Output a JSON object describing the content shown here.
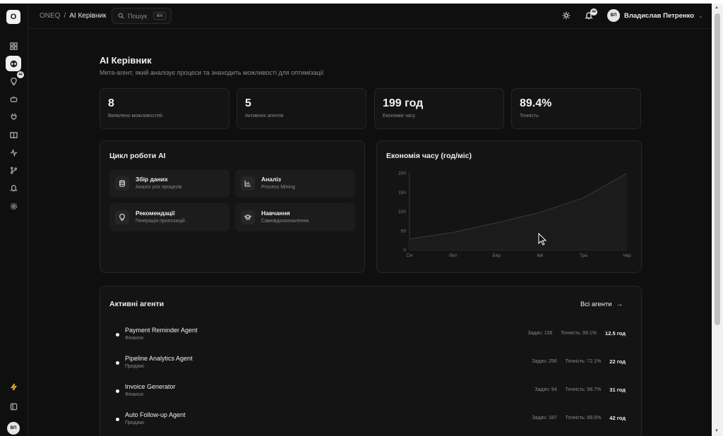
{
  "sidebar": {
    "logo": "O",
    "badge": "44",
    "avatar": "ВП",
    "icons": [
      "dashboard-icon",
      "brain-icon",
      "lightbulb-icon",
      "bot-icon",
      "plug-icon",
      "book-icon",
      "activity-icon",
      "git-branch-icon",
      "bell-icon",
      "settings-icon",
      "zap-icon",
      "sidebar-toggle-icon"
    ]
  },
  "topbar": {
    "crumb_root": "ONEQ",
    "crumb_sep": "/",
    "crumb_current": "AI Керівник",
    "search_placeholder": "Пошук",
    "search_shortcut": "⌘K",
    "notif_count": "44",
    "user_initials": "ВП",
    "user_name": "Владислав Петренко"
  },
  "page": {
    "title": "AI Керівник",
    "subtitle": "Мета-агент, який аналізує процеси та знаходить можливості для оптимізації"
  },
  "stats": [
    {
      "value": "8",
      "label": "Виявлено можливостей"
    },
    {
      "value": "5",
      "label": "Активних агентів"
    },
    {
      "value": "199 год",
      "label": "Економія часу"
    },
    {
      "value": "89.4%",
      "label": "Точність"
    }
  ],
  "cycle": {
    "title": "Цикл роботи AI",
    "items": [
      {
        "name": "Збір даних",
        "desc": "Аналіз усіх процесів"
      },
      {
        "name": "Аналіз",
        "desc": "Process Mining"
      },
      {
        "name": "Рекомендації",
        "desc": "Генерація пропозицій"
      },
      {
        "name": "Навчання",
        "desc": "Самовдосконалення"
      }
    ]
  },
  "savings_chart_title": "Економія часу (год/міс)",
  "chart_data": {
    "type": "area",
    "title": "Економія часу (год/міс)",
    "categories": [
      "Січ",
      "Лют",
      "Бер",
      "Кві",
      "Тра",
      "Чер"
    ],
    "values": [
      28,
      45,
      70,
      97,
      135,
      199
    ],
    "yticks": [
      0,
      50,
      100,
      150,
      200
    ],
    "ylim": [
      0,
      200
    ],
    "color": "#3a3a3a"
  },
  "agents": {
    "title": "Активні агенти",
    "all_link": "Всі агенти",
    "list": [
      {
        "name": "Payment Reminder Agent",
        "dept": "Фінанси",
        "tasks": "Задач: 156",
        "accuracy": "Точність: 99.1%",
        "hours": "12.5 год"
      },
      {
        "name": "Pipeline Analytics Agent",
        "dept": "Продажі",
        "tasks": "Задач: 256",
        "accuracy": "Точність: 72.1%",
        "hours": "22 год"
      },
      {
        "name": "Invoice Generator",
        "dept": "Фінанси",
        "tasks": "Задач: 94",
        "accuracy": "Точність: 98.7%",
        "hours": "31 год"
      },
      {
        "name": "Auto Follow-up Agent",
        "dept": "Продажі",
        "tasks": "Задач: 187",
        "accuracy": "Точність: 89.5%",
        "hours": "42 год"
      }
    ]
  }
}
